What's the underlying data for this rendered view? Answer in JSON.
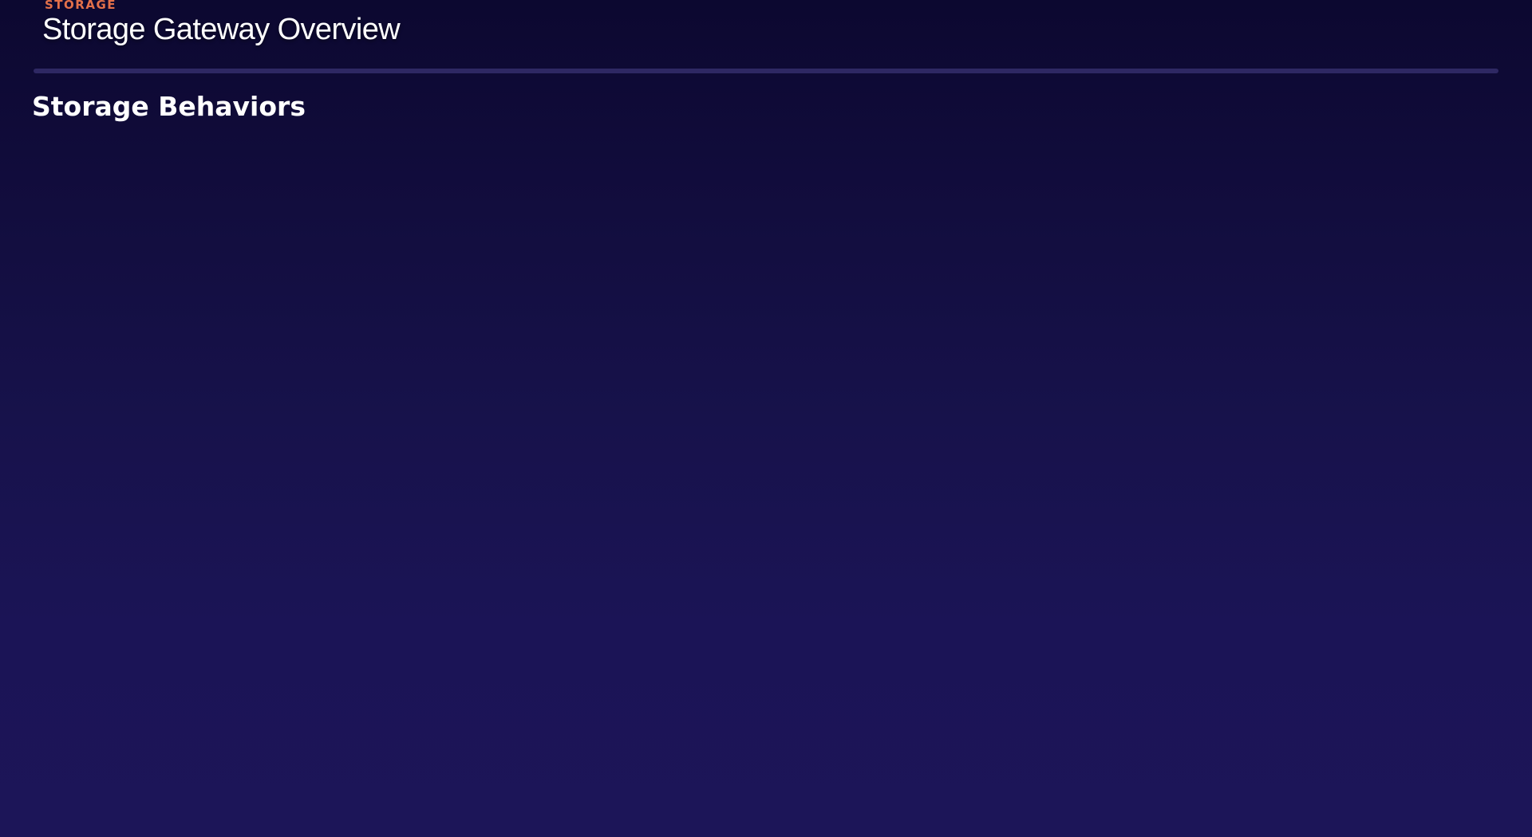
{
  "header": {
    "eyebrow": "STORAGE",
    "title": "Storage Gateway Overview"
  },
  "section": {
    "title": "Storage Behaviors"
  },
  "colors": {
    "background_top": "#0c0830",
    "background_bottom": "#1c1558",
    "accent": "#e2704a",
    "divider": "#2e2863",
    "text": "#ffffff"
  }
}
